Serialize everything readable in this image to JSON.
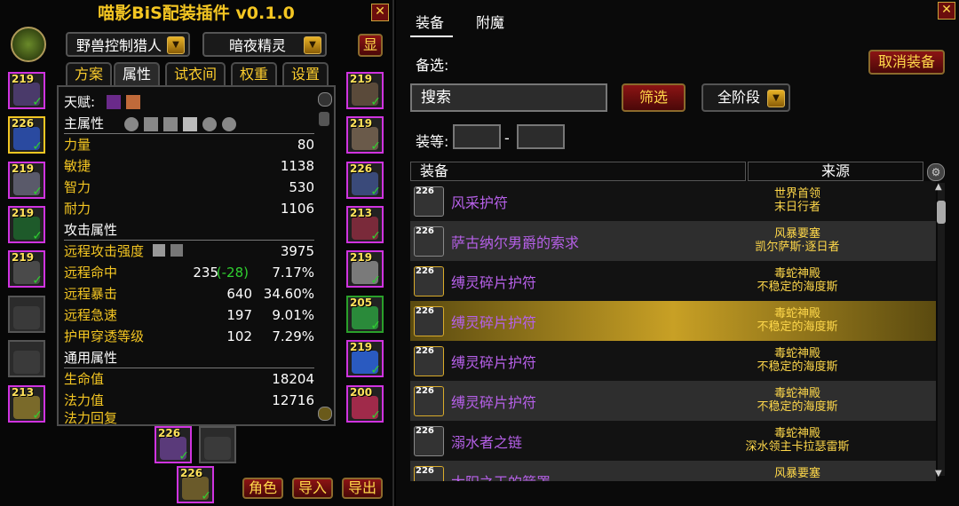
{
  "left": {
    "title": "喵影BiS配装插件 v0.1.0",
    "close_glyph": "✕",
    "spec_dropdown": "野兽控制猎人",
    "preset_dropdown": "暗夜精灵",
    "show_button": "显",
    "tabs": [
      "方案",
      "属性",
      "试衣间",
      "权重",
      "设置"
    ],
    "active_tab": "属性",
    "talent_label": "天赋:",
    "main_attr_label": "主属性",
    "stats_main": [
      {
        "label": "力量",
        "value": "80"
      },
      {
        "label": "敏捷",
        "value": "1138"
      },
      {
        "label": "智力",
        "value": "530"
      },
      {
        "label": "耐力",
        "value": "1106"
      }
    ],
    "attack_section": "攻击属性",
    "stats_attack": [
      {
        "label": "远程攻击强度",
        "mid": "",
        "value": "3975"
      },
      {
        "label": "远程命中",
        "mid": "235",
        "mid_green": "(-28)",
        "value": "7.17%"
      },
      {
        "label": "远程暴击",
        "mid": "640",
        "value": "34.60%"
      },
      {
        "label": "远程急速",
        "mid": "197",
        "value": "9.01%"
      },
      {
        "label": "护甲穿透等级",
        "mid": "102",
        "value": "7.29%"
      }
    ],
    "general_section": "通用属性",
    "stats_general": [
      {
        "label": "生命值",
        "value": "18204"
      },
      {
        "label": "法力值",
        "value": "12716"
      },
      {
        "label": "法力回复",
        "value": ""
      }
    ],
    "left_slots": [
      "219",
      "226",
      "219",
      "219",
      "219",
      "",
      "",
      "213"
    ],
    "right_slots": [
      "219",
      "219",
      "226",
      "213",
      "219",
      "205",
      "219",
      "200"
    ],
    "bottom_slots": [
      "226",
      "",
      "226"
    ],
    "bottom_buttons": [
      "角色",
      "导入",
      "导出"
    ]
  },
  "right": {
    "tabs": [
      "装备",
      "附魔"
    ],
    "active_tab": "装备",
    "close_glyph": "✕",
    "alt_label": "备选:",
    "cancel_button": "取消装备",
    "search_placeholder": "搜索",
    "filter_button": "筛选",
    "phase_dropdown": "全阶段",
    "ilvl_label": "装等:",
    "ilvl_dash": "-",
    "col_item": "装备",
    "col_source": "来源",
    "rows": [
      {
        "ilvl": "226",
        "name": "风采护符",
        "src1": "世界首领",
        "src2": "末日行者"
      },
      {
        "ilvl": "226",
        "name": "萨古纳尔男爵的索求",
        "src1": "风暴要塞",
        "src2": "凯尔萨斯·逐日者"
      },
      {
        "ilvl": "226",
        "name": "缚灵碎片护符",
        "src1": "毒蛇神殿",
        "src2": "不稳定的海度斯"
      },
      {
        "ilvl": "226",
        "name": "缚灵碎片护符",
        "src1": "毒蛇神殿",
        "src2": "不稳定的海度斯"
      },
      {
        "ilvl": "226",
        "name": "缚灵碎片护符",
        "src1": "毒蛇神殿",
        "src2": "不稳定的海度斯"
      },
      {
        "ilvl": "226",
        "name": "缚灵碎片护符",
        "src1": "毒蛇神殿",
        "src2": "不稳定的海度斯"
      },
      {
        "ilvl": "226",
        "name": "溺水者之链",
        "src1": "毒蛇神殿",
        "src2": "深水领主卡拉瑟雷斯"
      },
      {
        "ilvl": "226",
        "name": "太阳之王的箭罩",
        "src1": "风暴要塞",
        "src2": ""
      }
    ],
    "selected_row": 3
  },
  "colors": {
    "gold": "#f4c622",
    "purple": "#b660e8",
    "border_epic": "#d033e0"
  }
}
